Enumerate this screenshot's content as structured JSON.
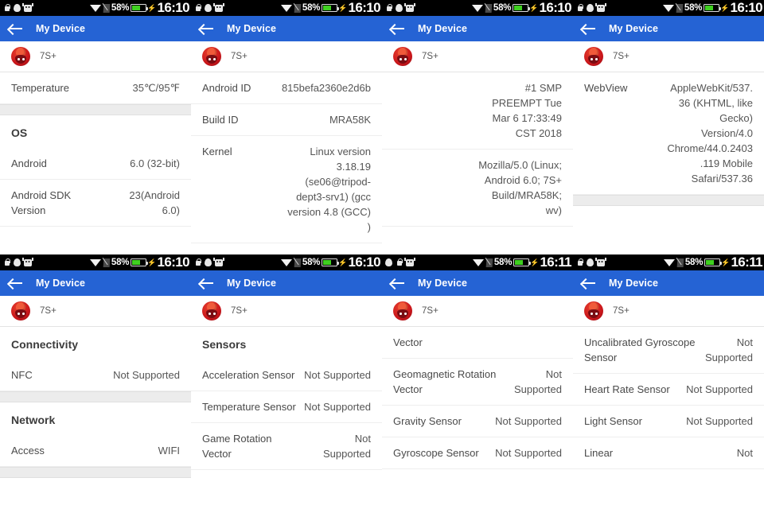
{
  "app": {
    "bar_title": "My Device",
    "device_name": "7S+",
    "back_icon": "back-arrow-icon",
    "logo_icon": "antutu-logo-icon",
    "accent_color": "#2563d4",
    "statusbar_bg": "#000000",
    "section_gap_color": "#ececec"
  },
  "status_bar": {
    "battery_percent": "58%",
    "battery_level": 58,
    "charging": true,
    "time_early": "16:10",
    "time_late": "16:11",
    "icons_variant_a": [
      "lock-icon",
      "drop-icon",
      "robot-icon"
    ],
    "icons_variant_b": [
      "drop-icon",
      "lock-icon",
      "robot-icon"
    ],
    "right_icons": [
      "wifi-icon",
      "sim-card-icon",
      "battery-icon",
      "charging-bolt-icon"
    ]
  },
  "panels": [
    {
      "id": "panel-1",
      "time": "16:10",
      "icon_variant": "a",
      "blocks": [
        {
          "type": "row",
          "label": "Temperature",
          "value": "35℃/95℉"
        },
        {
          "type": "gap"
        },
        {
          "type": "head",
          "label": "OS"
        },
        {
          "type": "row",
          "label": "Android",
          "value": "6.0 (32-bit)"
        },
        {
          "type": "row",
          "label": "Android SDK Version",
          "value": "23(Android 6.0)"
        }
      ]
    },
    {
      "id": "panel-2",
      "time": "16:10",
      "icon_variant": "a",
      "blocks": [
        {
          "type": "row",
          "label": "Android ID",
          "value": "815befa2360e2d6b"
        },
        {
          "type": "row",
          "label": "Build ID",
          "value": "MRA58K"
        },
        {
          "type": "row",
          "label": "Kernel",
          "value": "Linux version 3.18.19 (se06@tripod-dept3-srv1) (gcc version 4.8 (GCC) )"
        }
      ]
    },
    {
      "id": "panel-3",
      "time": "16:10",
      "icon_variant": "a",
      "blocks": [
        {
          "type": "row",
          "label": "",
          "value": "#1 SMP PREEMPT Tue Mar 6 17:33:49 CST 2018"
        },
        {
          "type": "row",
          "label": "",
          "value": "Mozilla/5.0 (Linux; Android 6.0; 7S+ Build/MRA58K; wv)"
        }
      ]
    },
    {
      "id": "panel-4",
      "time": "16:10",
      "icon_variant": "a",
      "blocks": [
        {
          "type": "row",
          "label": "WebView",
          "value": "AppleWebKit/537.36 (KHTML, like Gecko) Version/4.0 Chrome/44.0.2403.119 Mobile Safari/537.36"
        },
        {
          "type": "gap"
        }
      ]
    },
    {
      "id": "panel-5",
      "time": "16:10",
      "icon_variant": "a",
      "blocks": [
        {
          "type": "head",
          "label": "Connectivity"
        },
        {
          "type": "row",
          "label": "NFC",
          "value": "Not Supported"
        },
        {
          "type": "gap"
        },
        {
          "type": "head",
          "label": "Network"
        },
        {
          "type": "row",
          "label": "Access",
          "value": "WIFI"
        },
        {
          "type": "gap"
        }
      ]
    },
    {
      "id": "panel-6",
      "time": "16:10",
      "icon_variant": "a",
      "blocks": [
        {
          "type": "head",
          "label": "Sensors"
        },
        {
          "type": "row",
          "label": "Acceleration Sensor",
          "value": "Not Supported"
        },
        {
          "type": "row",
          "label": "Temperature Sensor",
          "value": "Not Supported"
        },
        {
          "type": "row",
          "label": "Game Rotation Vector",
          "value": "Not Supported"
        }
      ]
    },
    {
      "id": "panel-7",
      "time": "16:11",
      "icon_variant": "b",
      "blocks": [
        {
          "type": "row",
          "label": "Vector",
          "value": ""
        },
        {
          "type": "row",
          "label": "Geomagnetic Rotation Vector",
          "value": "Not Supported"
        },
        {
          "type": "row",
          "label": "Gravity Sensor",
          "value": "Not Supported"
        },
        {
          "type": "row",
          "label": "Gyroscope Sensor",
          "value": "Not Supported"
        }
      ]
    },
    {
      "id": "panel-8",
      "time": "16:11",
      "icon_variant": "a",
      "blocks": [
        {
          "type": "row",
          "label": "Uncalibrated Gyroscope Sensor",
          "value": "Not Supported"
        },
        {
          "type": "row",
          "label": "Heart Rate Sensor",
          "value": "Not Supported"
        },
        {
          "type": "row",
          "label": "Light Sensor",
          "value": "Not Supported"
        },
        {
          "type": "row",
          "label": "Linear",
          "value": "Not"
        }
      ]
    }
  ]
}
